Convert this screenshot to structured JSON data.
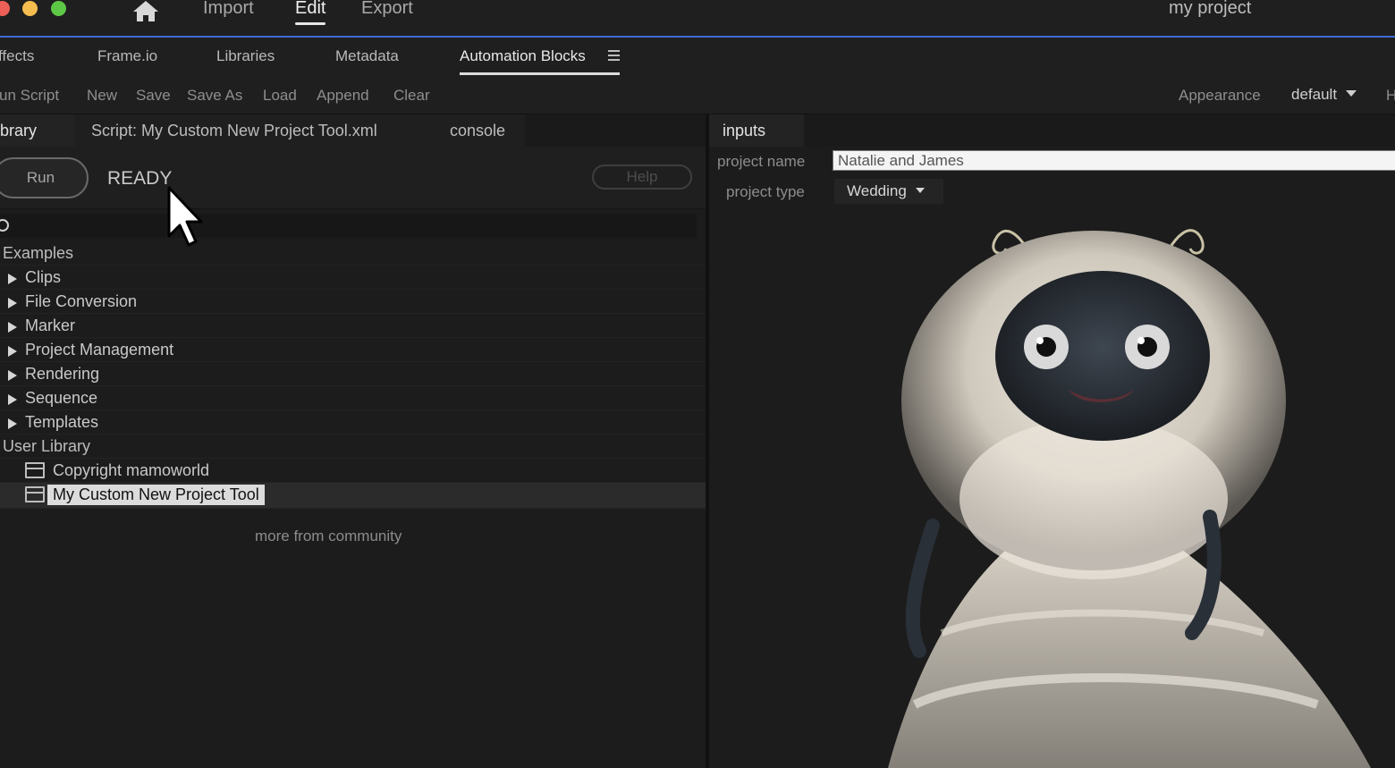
{
  "titlebar": {
    "nav": [
      "Import",
      "Edit",
      "Export"
    ],
    "active_nav": "Edit",
    "project_title": "my project",
    "accent_color": "#3d6bd6"
  },
  "panel_tabs": [
    "ffects",
    "Frame.io",
    "Libraries",
    "Metadata",
    "Automation Blocks"
  ],
  "toolbar": {
    "buttons": [
      "un Script",
      "New",
      "Save",
      "Save As",
      "Load",
      "Append",
      "Clear"
    ],
    "appearance_label": "Appearance",
    "appearance_value": "default",
    "cut_label": "H"
  },
  "left_panel": {
    "tabs": [
      "brary",
      "Script: My Custom New Project Tool.xml",
      "console"
    ],
    "run_label": "Run",
    "status": "READY",
    "help_label": "Help",
    "tree": {
      "examples_label": "Examples",
      "folders": [
        "Clips",
        "File Conversion",
        "Marker",
        "Project Management",
        "Rendering",
        "Sequence",
        "Templates"
      ],
      "user_library_label": "User Library",
      "scripts": [
        "Copyright mamoworld",
        "My Custom New Project Tool"
      ],
      "selected_script": "My Custom New Project Tool"
    },
    "community_link": "more from community"
  },
  "right_panel": {
    "tab": "inputs",
    "project_name_label": "project name",
    "project_name_value": "Natalie and James",
    "project_type_label": "project type",
    "project_type_value": "Wedding"
  }
}
